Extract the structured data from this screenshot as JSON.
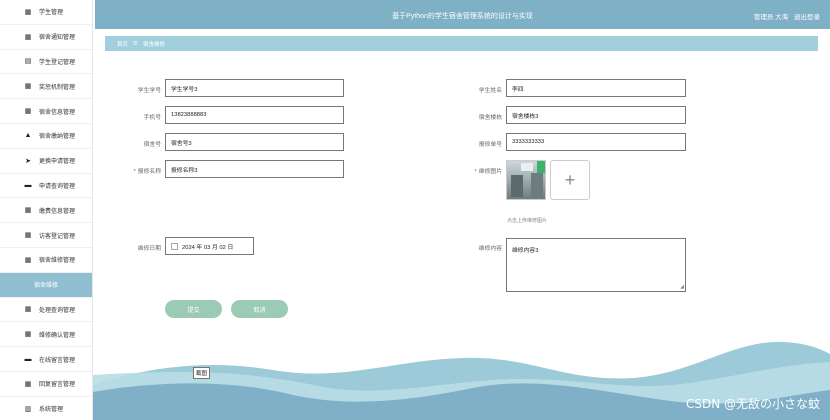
{
  "sidebar": {
    "items": [
      {
        "label": "学生管理",
        "icon": "grid-icon"
      },
      {
        "label": "宿舍通知管理",
        "icon": "grid-icon"
      },
      {
        "label": "学生登记管理",
        "icon": "clipboard-icon"
      },
      {
        "label": "奖惩机制管理",
        "icon": "grid-icon"
      },
      {
        "label": "宿舍信息管理",
        "icon": "grid-icon"
      },
      {
        "label": "宿舍缴纳管理",
        "icon": "thumbs-up-icon"
      },
      {
        "label": "更换申请管理",
        "icon": "send-icon"
      },
      {
        "label": "申请查询管理",
        "icon": "monitor-icon"
      },
      {
        "label": "缴费信息管理",
        "icon": "grid-icon"
      },
      {
        "label": "访客登记管理",
        "icon": "grid-icon"
      },
      {
        "label": "宿舍维修管理",
        "icon": "grid-icon"
      },
      {
        "label": "宿舍维修",
        "icon": "",
        "active": true
      },
      {
        "label": "处理查询管理",
        "icon": "grid-icon"
      },
      {
        "label": "维修确认管理",
        "icon": "grid-icon"
      },
      {
        "label": "在线留言管理",
        "icon": "monitor-icon"
      },
      {
        "label": "回复留言管理",
        "icon": "grid-icon"
      },
      {
        "label": "系统管理",
        "icon": "bars-icon"
      }
    ]
  },
  "header": {
    "title": "基于Python的学生宿舍管理系统的设计与实现",
    "user_label": "管理员 大海",
    "logout_label": "退出登录"
  },
  "breadcrumb": {
    "home": "首页",
    "separator": "☰",
    "current": "宿舍维修"
  },
  "form": {
    "student_id": {
      "label": "学生学号",
      "value": "学生学号3"
    },
    "student_name": {
      "label": "学生姓名",
      "value": "李四"
    },
    "phone": {
      "label": "手机号",
      "value": "13823888883"
    },
    "building": {
      "label": "宿舍楼栋",
      "value": "宿舍楼栋3"
    },
    "room_no": {
      "label": "宿舍号",
      "value": "宿舍号3"
    },
    "repair_no": {
      "label": "报修单号",
      "value": "3333333333"
    },
    "repair_name": {
      "label": "报修名称",
      "value": "报修名称3",
      "required": "*"
    },
    "repair_image": {
      "label": "维修图片",
      "required": "*",
      "hint": "点击上传维修图片",
      "upload_symbol": "+"
    },
    "repair_date": {
      "label": "维修日期",
      "value": "2024 年 03 月 02 日"
    },
    "repair_content": {
      "label": "维修内容",
      "value": "维修内容3"
    }
  },
  "buttons": {
    "submit": "提交",
    "cancel": "取消"
  },
  "overlay": {
    "screenshot_tag": "截图",
    "watermark": "CSDN @无敌の小さな蚊"
  },
  "colors": {
    "header_bg": "#7eb0c6",
    "breadcrumb_bg": "#a2cfdd",
    "active_menu_bg": "#8fbfd0",
    "button_bg": "#9bcbb4",
    "required_mark": "#e0403c"
  }
}
